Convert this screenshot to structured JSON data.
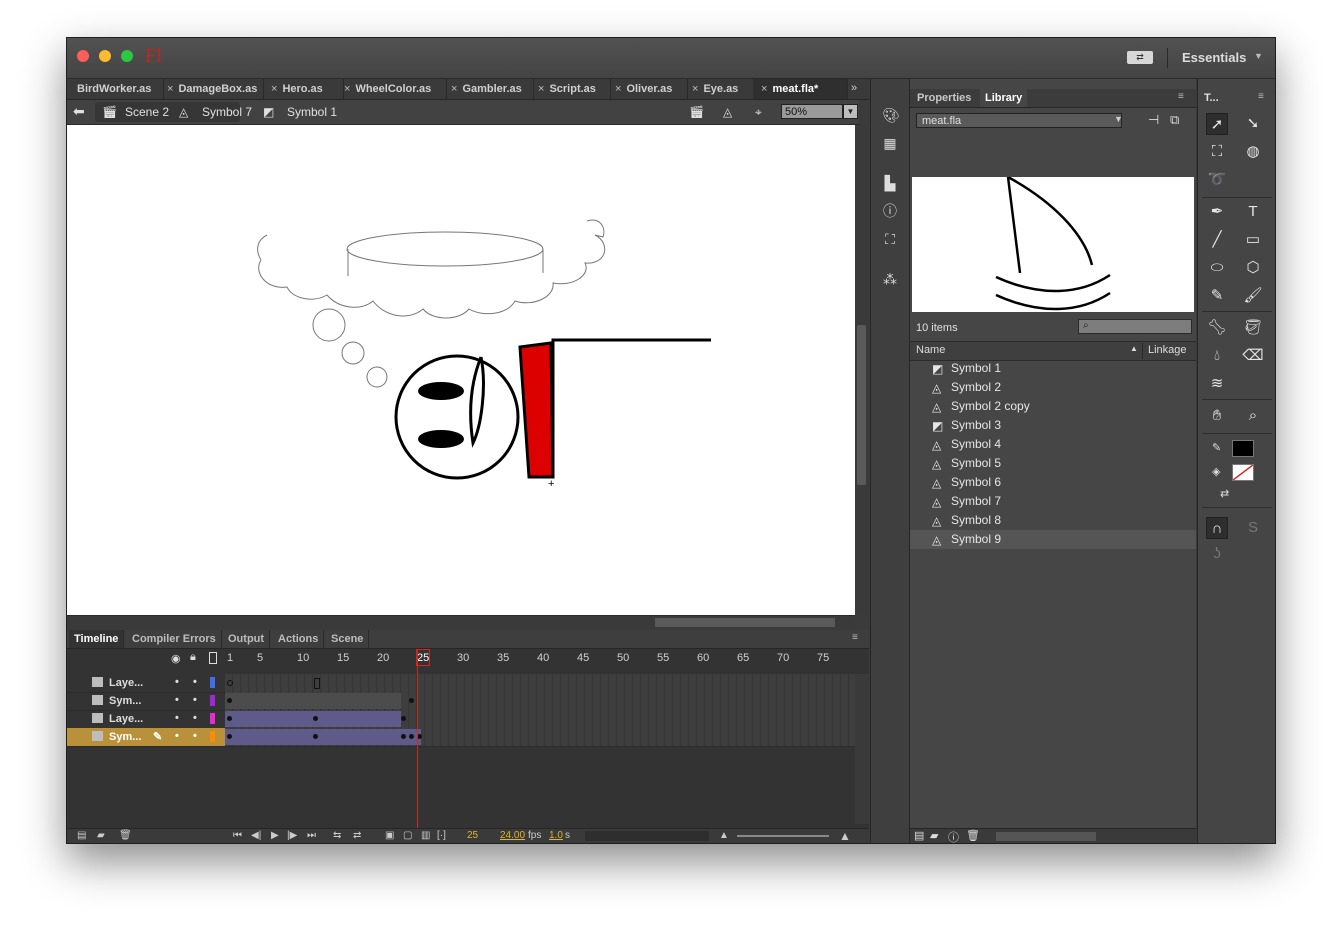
{
  "app": {
    "logo": "Fl",
    "workspace": "Essentials"
  },
  "doc_tabs": [
    "BirdWorker.as",
    "DamageBox.as",
    "Hero.as",
    "WheelColor.as",
    "Gambler.as",
    "Script.as",
    "Oliver.as",
    "Eye.as",
    "meat.fla*"
  ],
  "edit_bar": {
    "scene": "Scene 2",
    "symbol_a": "Symbol 7",
    "symbol_b": "Symbol 1",
    "zoom": "50%"
  },
  "timeline": {
    "tabs": [
      "Timeline",
      "Compiler Errors",
      "Output",
      "Actions",
      "Scene"
    ],
    "ruler": [
      "1",
      "5",
      "10",
      "15",
      "20",
      "25",
      "30",
      "35",
      "40",
      "45",
      "50",
      "55",
      "60",
      "65",
      "70",
      "75"
    ],
    "layers": [
      {
        "name": "Laye...",
        "color": "#3e6ee8"
      },
      {
        "name": "Sym...",
        "color": "#9b2ad6"
      },
      {
        "name": "Laye...",
        "color": "#e62ad6"
      },
      {
        "name": "Sym...",
        "color": "#ff8c00"
      }
    ],
    "current_frame": "25",
    "fps": "24.00",
    "fps_unit": "fps",
    "elapsed": "1.0",
    "elapsed_unit": "s"
  },
  "library": {
    "tabs": [
      "Properties",
      "Library"
    ],
    "file": "meat.fla",
    "item_count": "10 items",
    "col_name": "Name",
    "col_linkage": "Linkage",
    "items": [
      "Symbol 1",
      "Symbol 2",
      "Symbol 2 copy",
      "Symbol 3",
      "Symbol 4",
      "Symbol 5",
      "Symbol 6",
      "Symbol 7",
      "Symbol 8",
      "Symbol 9"
    ]
  },
  "tools_panel": {
    "title": "T..."
  },
  "colors": {
    "accent_red": "#d0281e",
    "stroke_color": "#000000",
    "fill_color": "none",
    "stage_red": "#dd0000"
  }
}
